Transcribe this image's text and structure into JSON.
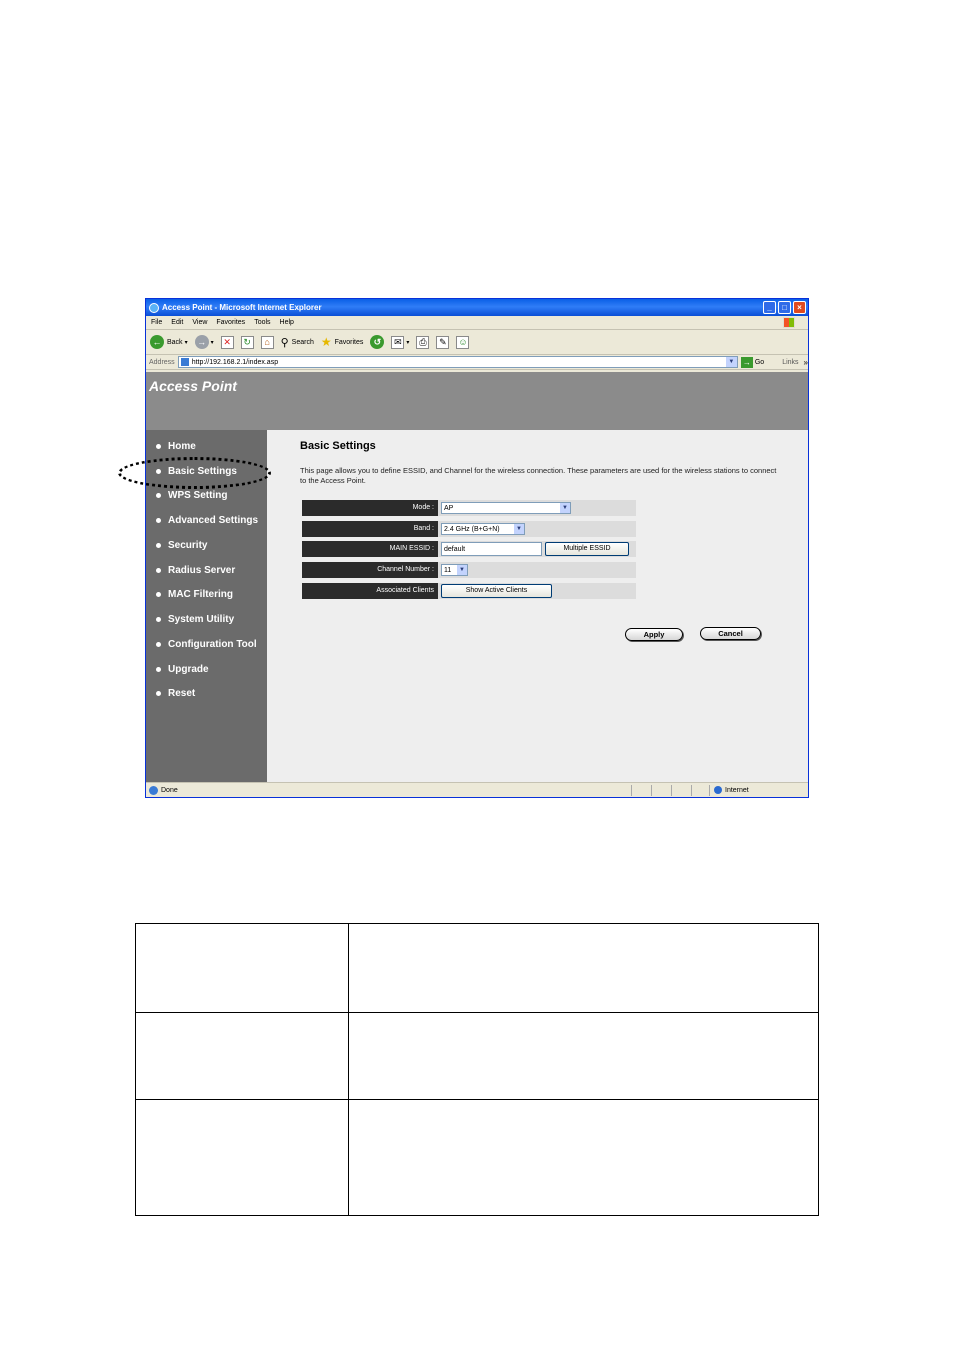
{
  "window": {
    "title": "Access Point - Microsoft Internet Explorer",
    "menu": [
      "File",
      "Edit",
      "View",
      "Favorites",
      "Tools",
      "Help"
    ],
    "toolbar": {
      "back": "Back",
      "search": "Search",
      "favorites": "Favorites"
    },
    "address": {
      "label": "Address",
      "url": "http://192.168.2.1/index.asp",
      "go": "Go",
      "links": "Links"
    },
    "status": {
      "text": "Done",
      "zone": "Internet"
    }
  },
  "app": {
    "brand": "Access Point"
  },
  "sidebar": {
    "items": [
      {
        "label": "Home"
      },
      {
        "label": "Basic Settings"
      },
      {
        "label": "WPS Setting"
      },
      {
        "label": "Advanced Settings"
      },
      {
        "label": "Security"
      },
      {
        "label": "Radius Server"
      },
      {
        "label": "MAC Filtering"
      },
      {
        "label": "System Utility"
      },
      {
        "label": "Configuration Tool"
      },
      {
        "label": "Upgrade"
      },
      {
        "label": "Reset"
      }
    ],
    "highlighted": "Basic Settings"
  },
  "main": {
    "title": "Basic Settings",
    "description": "This page allows you to define ESSID, and Channel for the wireless connection. These parameters are used for the wireless stations to connect to the Access Point.",
    "form": {
      "mode": {
        "label": "Mode :",
        "value": "AP"
      },
      "band": {
        "label": "Band :",
        "value": "2.4 GHz (B+G+N)"
      },
      "essid": {
        "label": "MAIN ESSID :",
        "value": "default",
        "button": "Multiple ESSID"
      },
      "channel": {
        "label": "Channel Number :",
        "value": "11"
      },
      "clients": {
        "label": "Associated Clients",
        "button": "Show Active Clients"
      }
    },
    "apply": "Apply",
    "cancel": "Cancel"
  }
}
